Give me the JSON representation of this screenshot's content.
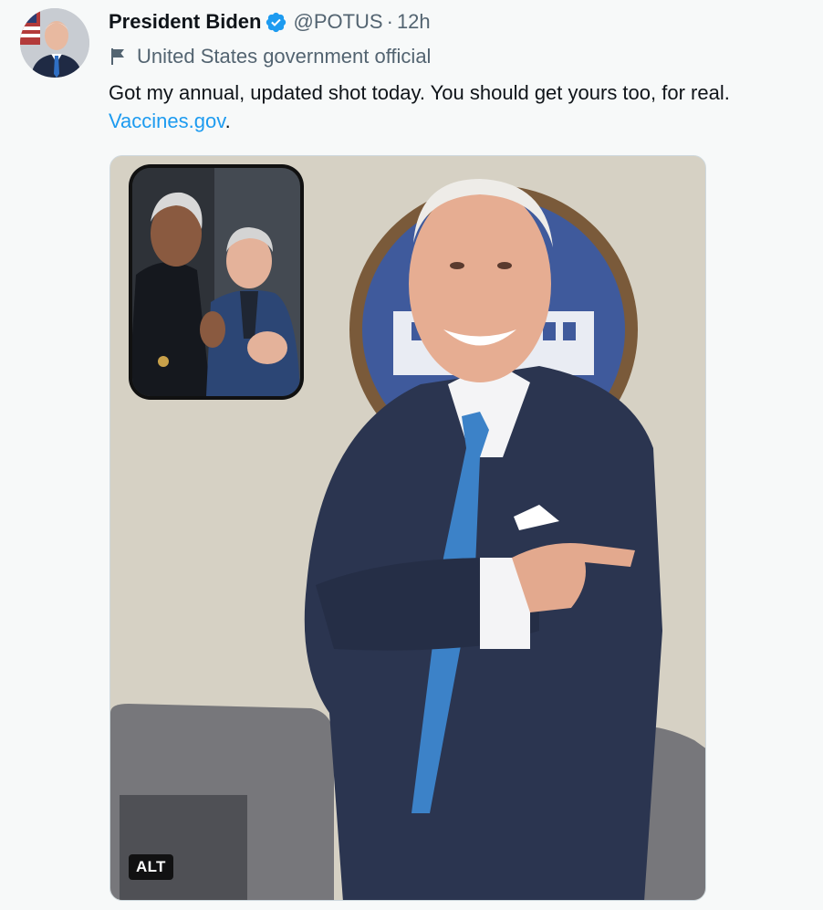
{
  "tweet": {
    "author": {
      "display_name": "President Biden",
      "handle": "@POTUS",
      "separator": "·",
      "time": "12h",
      "verified": true,
      "avatar_icon": "avatar-photo"
    },
    "label": {
      "icon": "flag-icon",
      "text": "United States government official"
    },
    "text_main": "Got my annual, updated shot today. You should get yours too, for real.",
    "link_text": "Vaccines.gov",
    "text_tail": "."
  },
  "media": {
    "alt_label": "ALT"
  },
  "colors": {
    "link": "#1d9bf0",
    "secondary_text": "#536471",
    "verified_badge": "#1d9bf0",
    "background": "#f7f9f9"
  }
}
